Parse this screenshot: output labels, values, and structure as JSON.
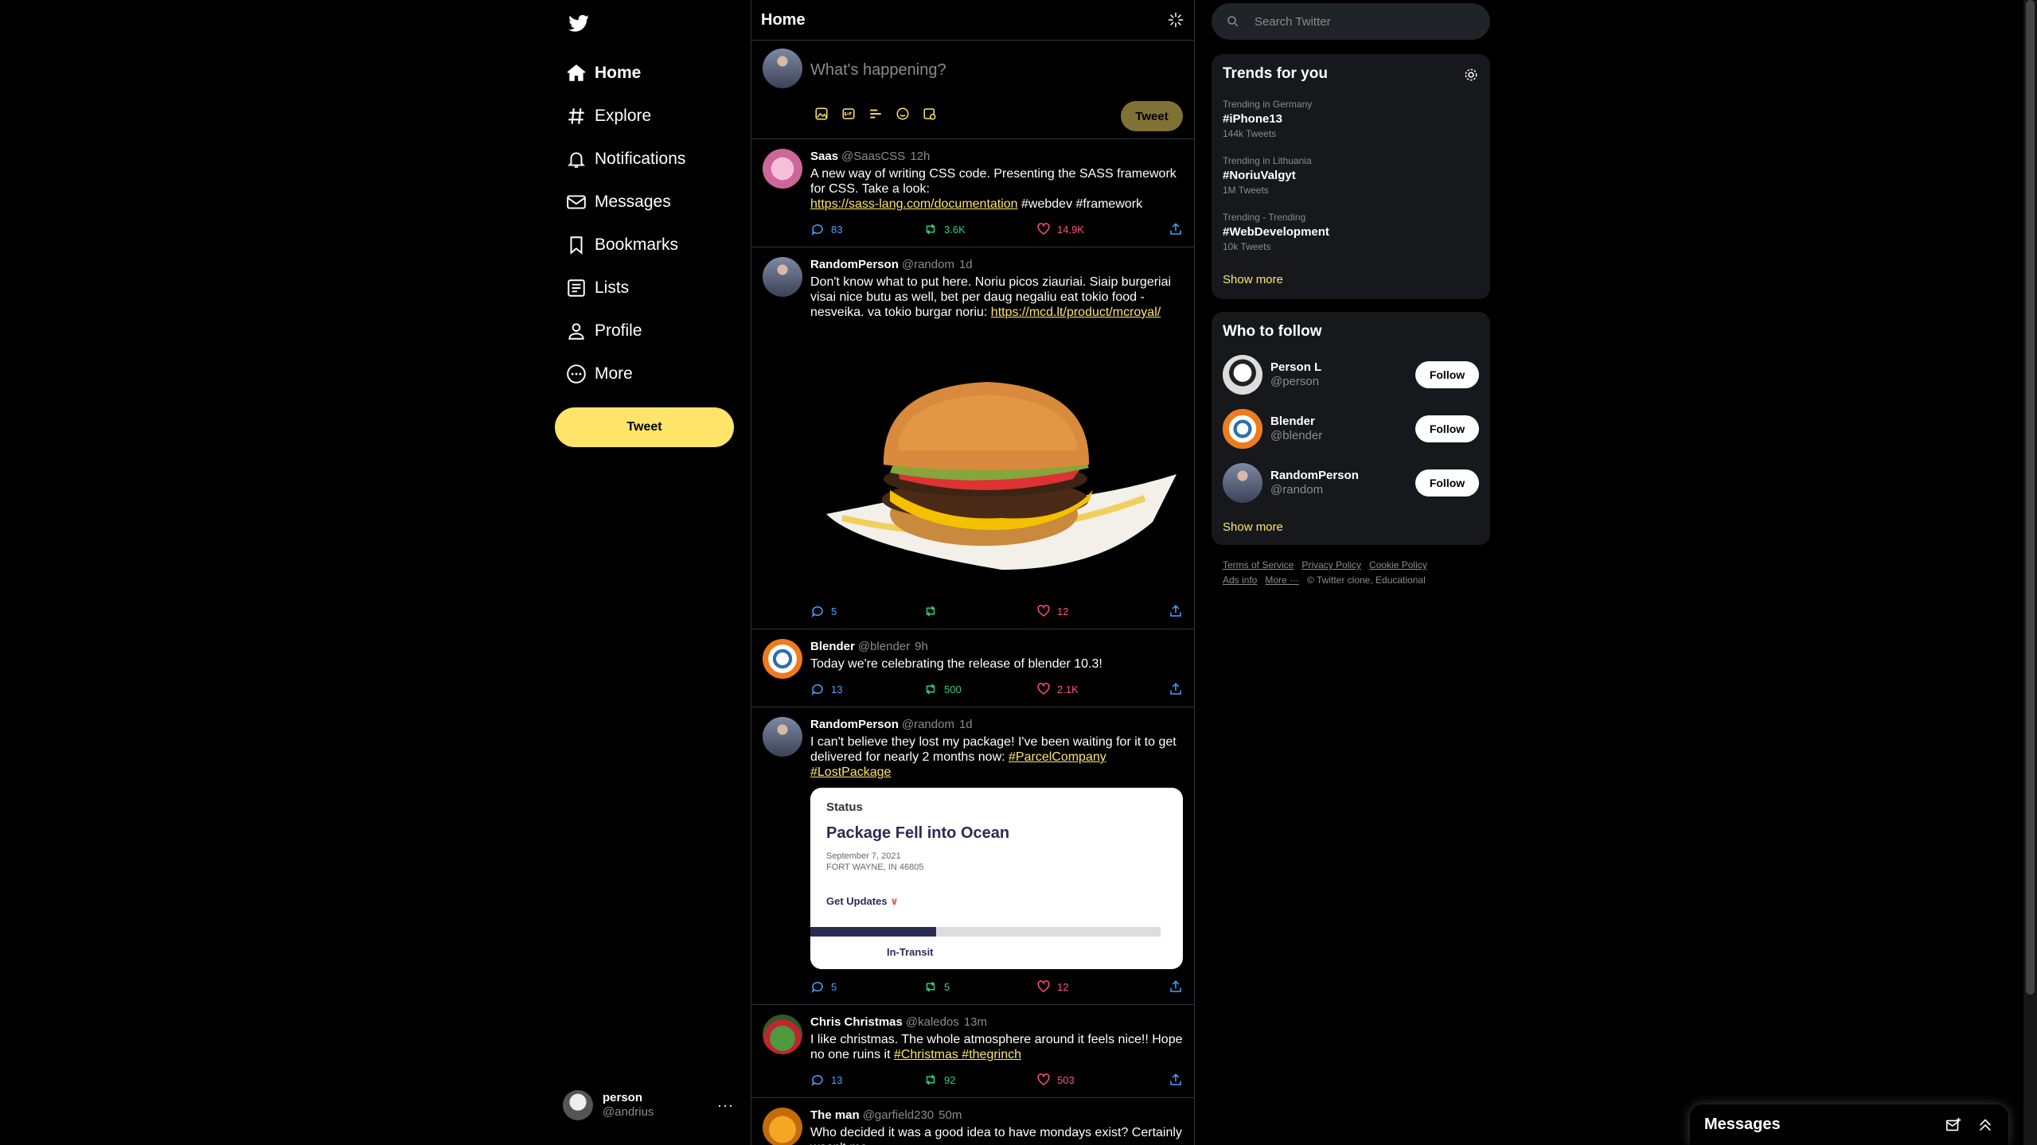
{
  "nav": {
    "items": [
      {
        "label": "Home",
        "icon": "home-icon"
      },
      {
        "label": "Explore",
        "icon": "hashtag-icon"
      },
      {
        "label": "Notifications",
        "icon": "bell-icon"
      },
      {
        "label": "Messages",
        "icon": "mail-icon"
      },
      {
        "label": "Bookmarks",
        "icon": "bookmark-icon"
      },
      {
        "label": "Lists",
        "icon": "list-icon"
      },
      {
        "label": "Profile",
        "icon": "user-icon"
      },
      {
        "label": "More",
        "icon": "more-circle-icon"
      }
    ],
    "tweet_label": "Tweet"
  },
  "me": {
    "name": "person",
    "handle": "@andrius"
  },
  "header": {
    "title": "Home"
  },
  "compose": {
    "placeholder": "What's happening?",
    "tweet_label": "Tweet"
  },
  "tweets": [
    {
      "name": "Saas",
      "handle": "@SaasCSS",
      "time": "12h",
      "text": "A new way of writing CSS code. Presenting the SASS framework for CSS. Take a look:",
      "link": "https://sass-lang.com/documentation",
      "tags": " #webdev #framework",
      "replies": "83",
      "retweets": "3.6K",
      "likes": "14.9K"
    },
    {
      "name": "RandomPerson",
      "handle": "@random",
      "time": "1d",
      "text": "Don't know what to put here. Noriu picos ziauriai. Siaip burgeriai visai nice butu as well, bet per daug negaliu eat tokio food - nesveika. va tokio burgar noriu: ",
      "link": "https://mcd.lt/product/mcroyal/",
      "replies": "5",
      "retweets": "",
      "likes": "12"
    },
    {
      "name": "Blender",
      "handle": "@blender",
      "time": "9h",
      "text": "Today we're celebrating the release of blender 10.3!",
      "replies": "13",
      "retweets": "500",
      "likes": "2.1K"
    },
    {
      "name": "RandomPerson",
      "handle": "@random",
      "time": "1d",
      "text": "I can't believe they lost my package! I've been waiting for it to get delivered for nearly 2 months now: ",
      "tags": "#ParcelCompany #LostPackage",
      "card": {
        "label": "Status",
        "title": "Package Fell into Ocean",
        "date": "September 7, 2021",
        "place": "FORT WAYNE, IN 46805",
        "updates": "Get Updates",
        "progress": 0.36,
        "state": "In-Transit"
      },
      "replies": "5",
      "retweets": "5",
      "likes": "12"
    },
    {
      "name": "Chris Christmas",
      "handle": "@kaledos",
      "time": "13m",
      "text": "I like christmas. The whole atmosphere around it feels nice!! Hope no one ruins it ",
      "tags": "#Christmas #thegrinch",
      "replies": "13",
      "retweets": "92",
      "likes": "503"
    },
    {
      "name": "The man",
      "handle": "@garfield230",
      "time": "50m",
      "text": "Who decided it was a good idea to have mondays exist? Certainly wasn't me"
    }
  ],
  "search": {
    "placeholder": "Search Twitter"
  },
  "trends": {
    "title": "Trends for you",
    "items": [
      {
        "context": "Trending in Germany",
        "tag": "#iPhone13",
        "count": "144k Tweets"
      },
      {
        "context": "Trending in Lithuania",
        "tag": "#NoriuValgyt",
        "count": "1M Tweets"
      },
      {
        "context": "Trending - Trending",
        "tag": "#WebDevelopment",
        "count": "10k Tweets"
      }
    ],
    "show_more": "Show more"
  },
  "follow": {
    "title": "Who to follow",
    "items": [
      {
        "name": "Person L",
        "handle": "@person",
        "button": "Follow"
      },
      {
        "name": "Blender",
        "handle": "@blender",
        "button": "Follow"
      },
      {
        "name": "RandomPerson",
        "handle": "@random",
        "button": "Follow"
      }
    ],
    "show_more": "Show more"
  },
  "footer": {
    "links": [
      "Terms of Service",
      "Privacy Policy",
      "Cookie Policy",
      "Ads info",
      "More ···"
    ],
    "copyright": "© Twitter clone, Educational"
  },
  "messages": {
    "title": "Messages"
  },
  "colors": {
    "accent": "#ffe46a",
    "background": "#000000",
    "panel": "#16181c",
    "reply": "#4aa3ff",
    "retweet": "#2ecf7b",
    "like": "#ff4f8b"
  }
}
